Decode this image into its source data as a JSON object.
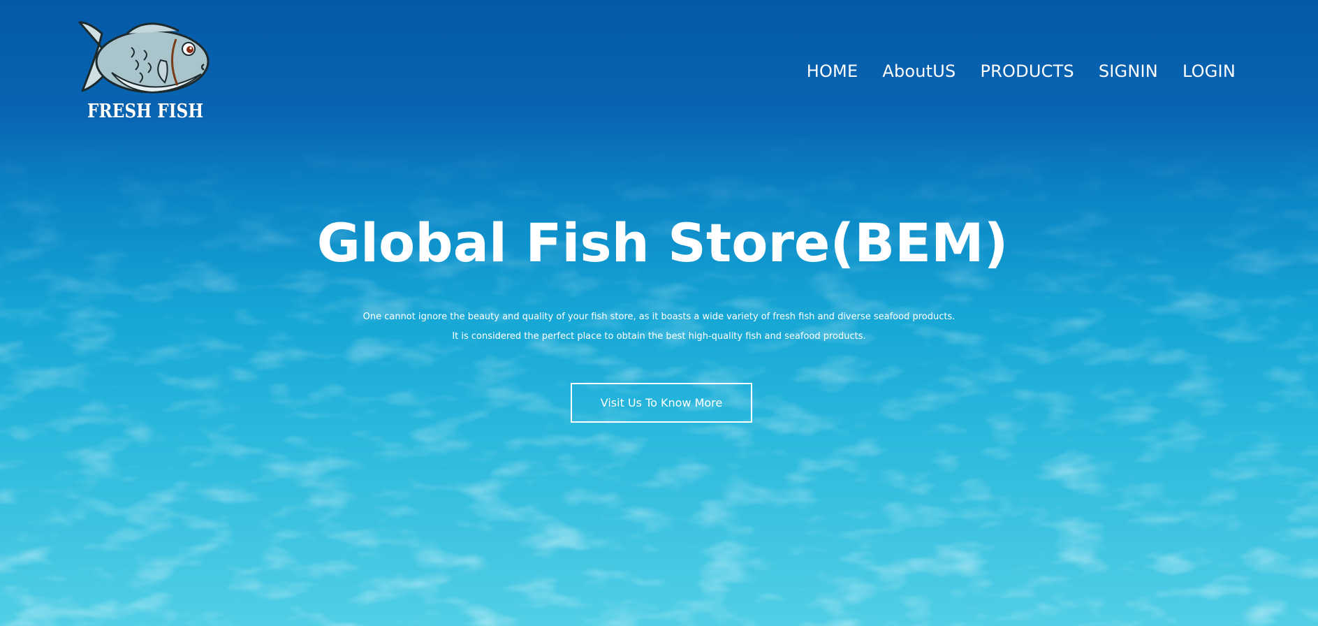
{
  "brand": {
    "logo_icon": "fish-icon",
    "name": "FRESH FISH"
  },
  "nav": {
    "items": [
      {
        "label": "HOME"
      },
      {
        "label": "AboutUS"
      },
      {
        "label": "PRODUCTS"
      },
      {
        "label": "SIGNIN"
      },
      {
        "label": "LOGIN"
      }
    ]
  },
  "hero": {
    "title": "Global Fish Store(BEM)",
    "description_line1": "One cannot ignore the beauty and quality of your fish store, as it boasts a wide variety of fresh fish and diverse seafood products.",
    "description_line2": "It is considered the perfect place to obtain the best high-quality fish and seafood products.",
    "cta_label": "Visit Us To Know More"
  },
  "colors": {
    "sky_top": "#0559a6",
    "water_light": "#52cfe6",
    "text": "#ffffff"
  }
}
